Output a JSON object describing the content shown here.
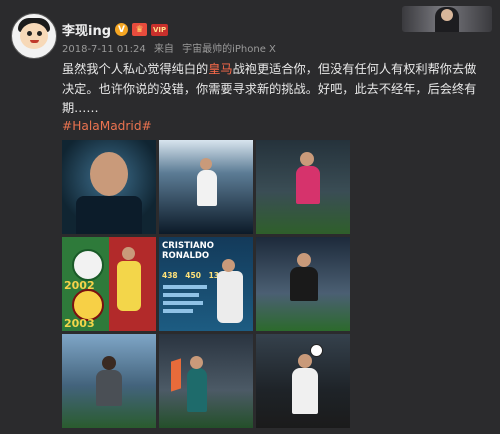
{
  "user": {
    "name": "李现ing",
    "badge_v": "V",
    "badge_crown": "♛",
    "badge_vip": "VIP"
  },
  "meta": {
    "date": "2018-7-11 01:24",
    "source_prefix": "来自",
    "source": "宇宙最帅的iPhone X"
  },
  "post": {
    "line1_before": "虽然我个人私心觉得纯白的",
    "line1_highlight": "皇马",
    "line1_after": "战袍更适合你，但没有任何人有权利帮你去做决定。也许你说的没错，你需要寻求新的挑战。好吧，此去不经年，后会终有期……",
    "hashtag": "#HalaMadrid#"
  },
  "tiles": {
    "t4": {
      "year1": "2002",
      "year2": "2003"
    },
    "t5": {
      "title_1": "CRISTIANO",
      "title_2": "RONALDO",
      "stat1": "438",
      "stat2": "450",
      "stat3": "131"
    }
  }
}
